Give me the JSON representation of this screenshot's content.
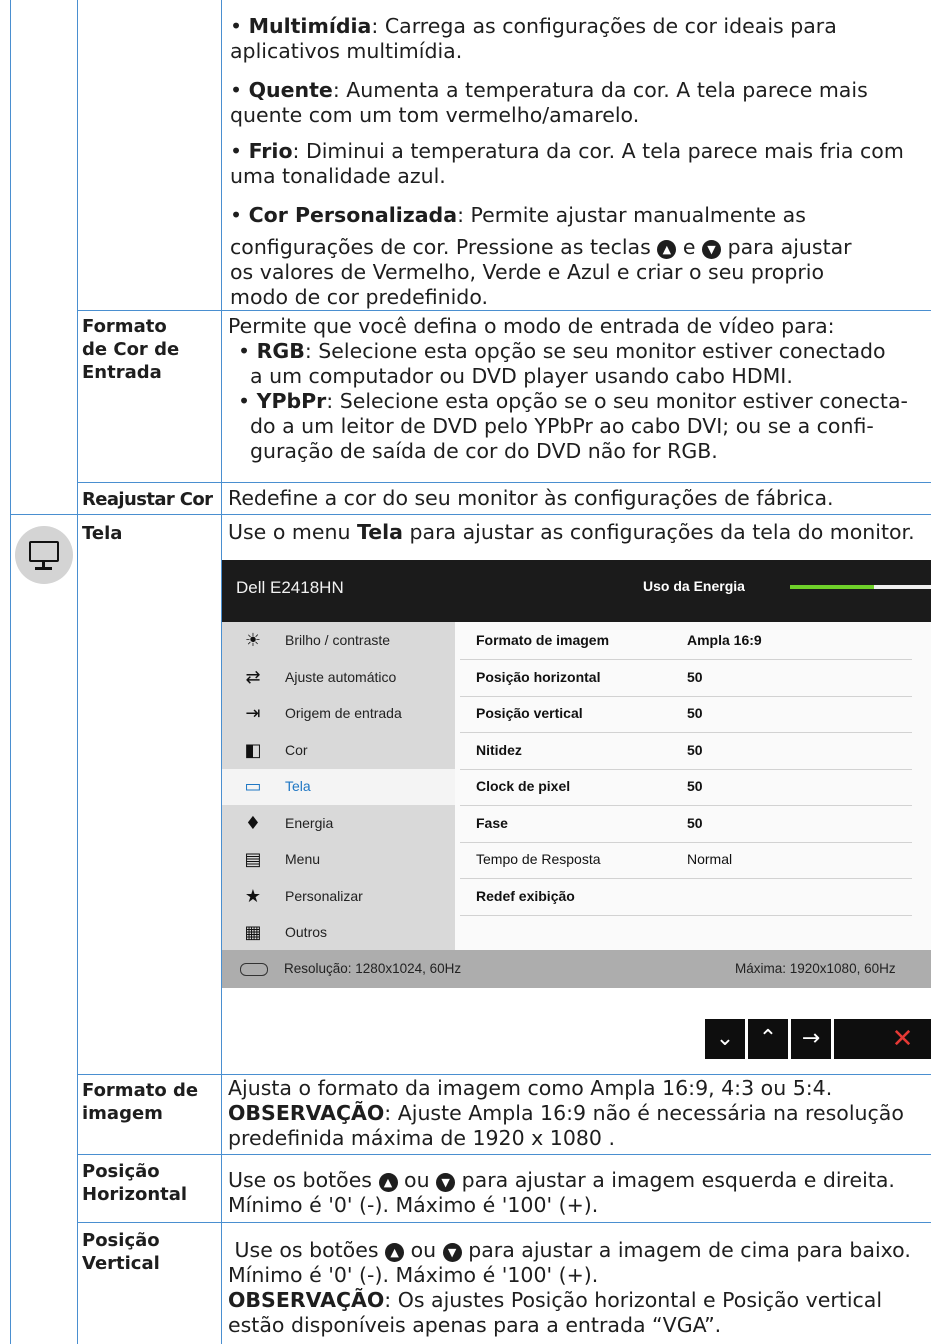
{
  "colors": {
    "accent_line": "#4a8fd0",
    "energy_bar": "#6fd12a",
    "close_x": "#e53935"
  },
  "presets": {
    "multimidia": {
      "term": "Multimídia",
      "rest": ": Carrega as configurações de cor ideais para aplicativos multimídia."
    },
    "quente": {
      "term": "Quente",
      "rest": ": Aumenta a temperatura da cor. A tela parece mais quente com um tom vermelho/amarelo."
    },
    "frio": {
      "term": "Frio",
      "rest": ": Diminui a temperatura da cor. A tela parece mais fria com uma tonalidade azul."
    },
    "personalizada": {
      "term": "Cor Personalizada",
      "rest_a": ": Permite ajustar manualmente as",
      "rest_b": "configurações de cor. Pressione as teclas",
      "and": "e",
      "rest_c": "para ajustar",
      "rest_d": "os valores de Vermelho, Verde e Azul e criar o seu proprio",
      "rest_e": "modo de cor predefinido."
    }
  },
  "formato_cor": {
    "label_1": "Formato",
    "label_2": "de Cor de",
    "label_3": "Entrada",
    "intro": "Permite que você defina o modo de entrada de vídeo para:",
    "rgb_term": "RGB",
    "rgb_1": ": Selecione esta opção se seu monitor estiver conectado",
    "rgb_2": "a um computador ou DVD player usando cabo HDMI.",
    "ypbpr_term": "YPbPr",
    "ypbpr_1": ": Selecione esta opção se o seu monitor estiver conecta-",
    "ypbpr_2": "do a um leitor de DVD pelo YPbPr ao cabo DVI; ou se a confi-",
    "ypbpr_3": "guração de saída de cor do DVD não for RGB."
  },
  "reajustar": {
    "label": "Reajustar Cor",
    "text": "Redefine a cor do seu monitor às configurações de fábrica."
  },
  "tela": {
    "label": "Tela",
    "text_a": "Use o menu ",
    "text_b": "Tela",
    "text_c": " para ajustar as configurações da tela do monitor."
  },
  "osd": {
    "model": "Dell E2418HN",
    "energy_label": "Uso da Energia",
    "energy_level": 0.6,
    "menu": [
      {
        "icon": "☀",
        "label": "Brilho / contraste"
      },
      {
        "icon": "⇄",
        "label": "Ajuste automático"
      },
      {
        "icon": "⇥",
        "label": "Origem de entrada"
      },
      {
        "icon": "◧",
        "label": "Cor"
      },
      {
        "icon": "▭",
        "label": "Tela"
      },
      {
        "icon": "♦",
        "label": "Energia"
      },
      {
        "icon": "▤",
        "label": "Menu"
      },
      {
        "icon": "★",
        "label": "Personalizar"
      },
      {
        "icon": "▦",
        "label": "Outros"
      }
    ],
    "rows": [
      {
        "label": "Formato de imagem",
        "value": "Ampla 16:9",
        "bold": true
      },
      {
        "label": "Posição horizontal",
        "value": "50",
        "bold": true
      },
      {
        "label": "Posição vertical",
        "value": "50",
        "bold": true
      },
      {
        "label": "Nitidez",
        "value": "50",
        "bold": true
      },
      {
        "label": "Clock de pixel",
        "value": "50",
        "bold": true
      },
      {
        "label": "Fase",
        "value": "50",
        "bold": true
      },
      {
        "label": "Tempo de Resposta",
        "value": "Normal",
        "bold": false
      },
      {
        "label": "Redef exibição",
        "value": "",
        "bold": true
      }
    ],
    "resolution": "Resolução: 1280x1024, 60Hz",
    "maximum": "Máxima: 1920x1080, 60Hz",
    "nav_icons": [
      "chevron-down-icon",
      "chevron-up-icon",
      "arrow-right-icon",
      "close-icon"
    ]
  },
  "formato_imagem": {
    "label_1": "Formato de",
    "label_2": "imagem",
    "line1": "Ajusta o formato da imagem como Ampla 16:9, 4:3 ou 5:4.",
    "obs": "OBSERVAÇÃO",
    "line2": ": Ajuste Ampla 16:9 não é necessária na resolução",
    "line3": "predefinida máxima de 1920 x 1080 ."
  },
  "pos_h": {
    "label_1": "Posição",
    "label_2": "Horizontal",
    "a": "Use os botões",
    "or": "ou",
    "b": "para ajustar a imagem esquerda e direita.",
    "line2": "Mínimo é '0' (-). Máximo é '100' (+)."
  },
  "pos_v": {
    "label_1": "Posição",
    "label_2": "Vertical",
    "a": "Use os botões",
    "or": "ou",
    "b": "para ajustar a imagem de cima para baixo.",
    "line2": "Mínimo é '0' (-). Máximo é '100' (+).",
    "obs": "OBSERVAÇÃO",
    "line3": ": Os ajustes Posição horizontal e Posição vertical",
    "line4": "estão disponíveis apenas para a entrada “VGA”."
  }
}
